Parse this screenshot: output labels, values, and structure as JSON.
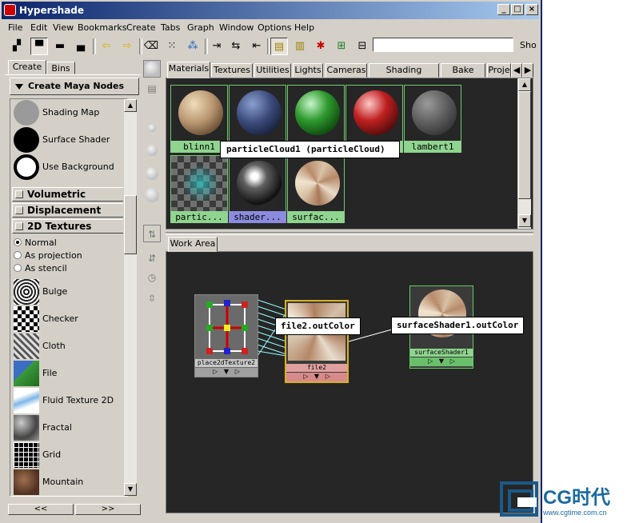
{
  "window": {
    "title": "Hypershade"
  },
  "menubar": [
    "File",
    "Edit",
    "View",
    "Bookmarks",
    "Create",
    "Tabs",
    "Graph",
    "Window",
    "Options",
    "Help"
  ],
  "toolbar": {
    "show_label": "Sho",
    "search_value": ""
  },
  "left_panel": {
    "tabs": [
      "Create",
      "Bins"
    ],
    "create_nodes_label": "Create Maya Nodes",
    "shader_items": [
      "Shading Map",
      "Surface Shader",
      "Use Background"
    ],
    "sections": [
      "Volumetric",
      "Displacement",
      "2D Textures"
    ],
    "projection_options": [
      "Normal",
      "As projection",
      "As stencil"
    ],
    "selected_projection": "Normal",
    "texture_items": [
      "Bulge",
      "Checker",
      "Cloth",
      "File",
      "Fluid Texture 2D",
      "Fractal",
      "Grid",
      "Mountain"
    ],
    "nav_prev": "<<",
    "nav_next": ">>"
  },
  "material_tabs": [
    "Materials",
    "Textures",
    "Utilities",
    "Lights",
    "Cameras",
    "Shading Groups",
    "Bake Sets",
    "Proje"
  ],
  "materials": [
    {
      "name": "blinn1"
    },
    {
      "name": ""
    },
    {
      "name": ""
    },
    {
      "name": ""
    },
    {
      "name": "lambert1"
    },
    {
      "name": "partic..."
    },
    {
      "name": "shader..."
    },
    {
      "name": "surfac..."
    }
  ],
  "tooltip": "particleCloud1 (particleCloud)",
  "work_area": {
    "tab_label": "Work Area",
    "nodes": {
      "place2d": "place2dTexture2",
      "file": "file2",
      "surface": "surfaceShader1"
    },
    "connection_labels": {
      "source": "file2.outColor",
      "target": "surfaceShader1.outColor"
    }
  },
  "watermark": {
    "brand": "CG时代",
    "url": "www.cgtime.com.cn"
  }
}
